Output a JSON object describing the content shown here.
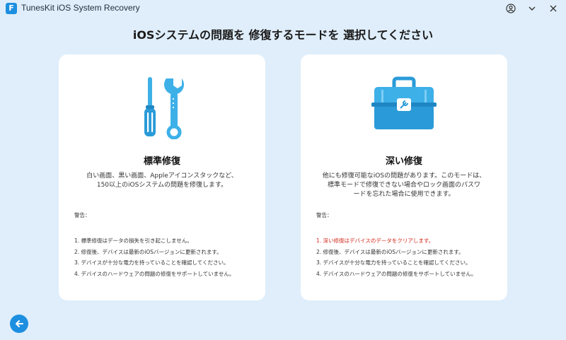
{
  "app": {
    "title": "TunesKit iOS System Recovery",
    "logo_glyph": "F"
  },
  "heading": "iOSシステムの問題を 修復するモードを 選択してください",
  "colors": {
    "background": "#dfeefa",
    "accent": "#1d8fe0",
    "danger": "#d0281c",
    "icon_blue": "#3db0e8"
  },
  "cards": [
    {
      "icon": "tools-icon",
      "title": "標準修復",
      "description_lines": [
        "白い画面、黒い画面、Appleアイコンスタックなど、",
        "150以上のiOSシステムの問題を修復します。"
      ],
      "warning_label": "警告：",
      "warnings": [
        "1. 標準修復はデータの損失を引き起こしません。",
        "2. 修復後、デバイスは最新のiOSバージョンに更新されます。",
        "3. デバイスが十分な電力を持っていることを確認してください。",
        "4. デバイスのハードウェアの問題の修復をサポートしていません。"
      ]
    },
    {
      "icon": "toolbox-icon",
      "title": "深い修復",
      "description_lines": [
        "他にも修復可能なiOSの問題があります。このモードは、",
        "標準モードで修復できない場合やロック画面のパスワ",
        "ードを忘れた場合に使用できます。"
      ],
      "warning_label": "警告：",
      "warnings": [
        "1. 深い修復はデバイスのデータをクリアします。",
        "2. 修復後、デバイスは最新のiOSバージョンに更新されます。",
        "3. デバイスが十分な電力を持っていることを確認してください。",
        "4. デバイスのハードウェアの問題の修復をサポートしていません。"
      ]
    }
  ],
  "window_controls": [
    "account-icon",
    "chevron-down-icon",
    "close-icon"
  ],
  "back_button": "back-arrow-icon"
}
